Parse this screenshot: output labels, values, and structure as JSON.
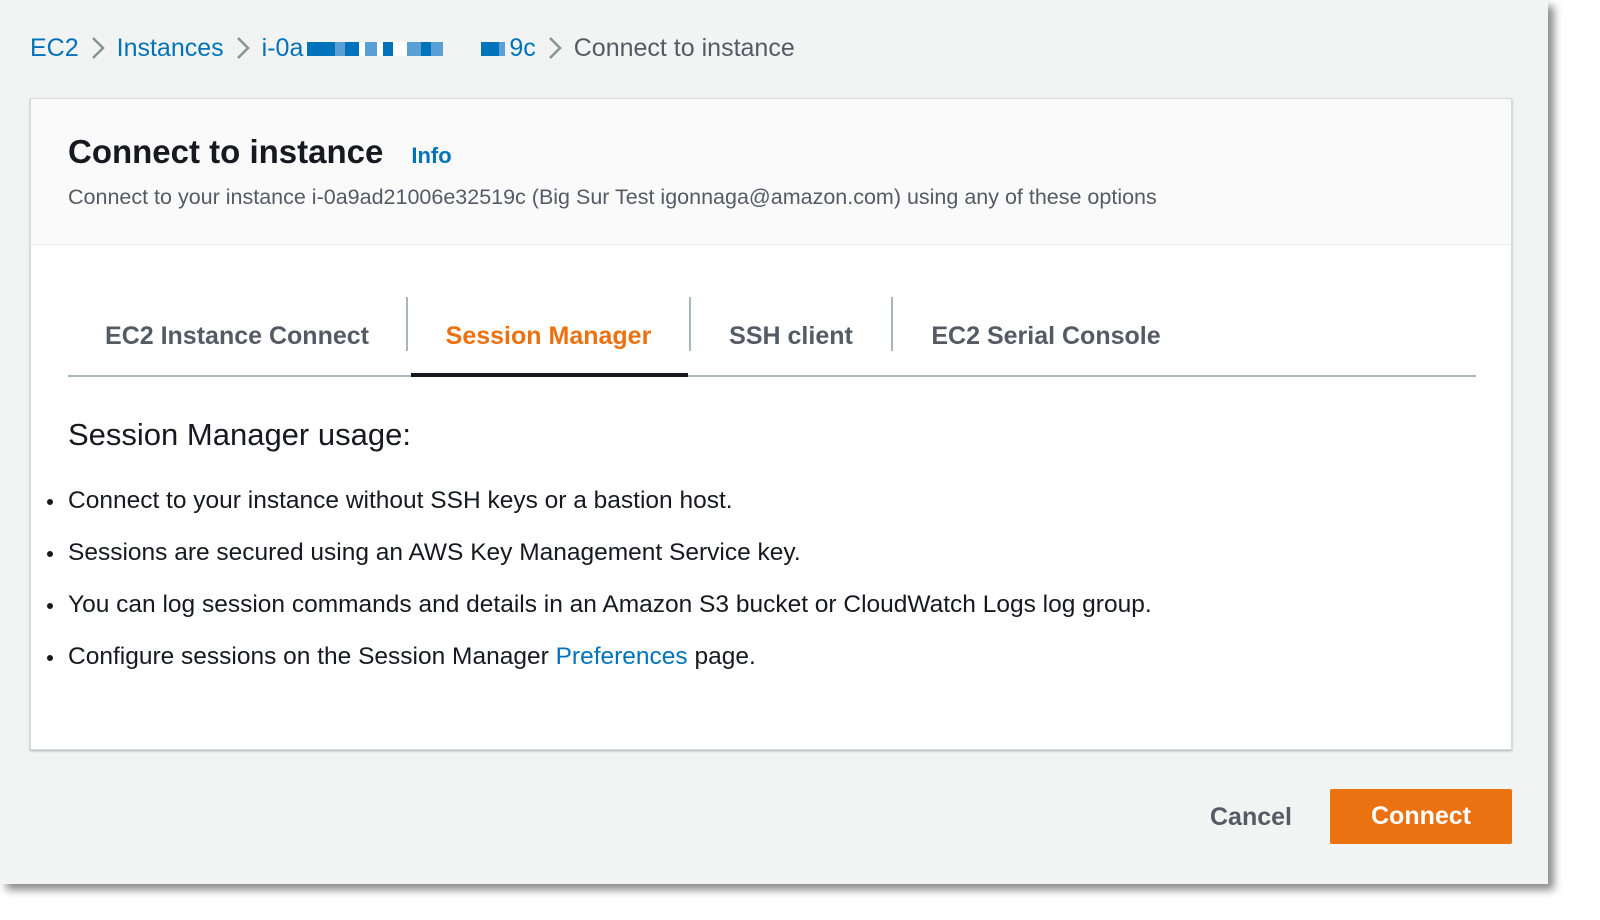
{
  "breadcrumb": {
    "items": [
      "EC2",
      "Instances",
      "i-0a",
      "9c"
    ],
    "current": "Connect to instance"
  },
  "header": {
    "title": "Connect to instance",
    "info_label": "Info",
    "description": "Connect to your instance i-0a9ad21006e32519c (Big Sur Test igonnaga@amazon.com) using any of these options"
  },
  "tabs": [
    {
      "label": "EC2 Instance Connect",
      "active": false
    },
    {
      "label": "Session Manager",
      "active": true
    },
    {
      "label": "SSH client",
      "active": false
    },
    {
      "label": "EC2 Serial Console",
      "active": false
    }
  ],
  "session_manager": {
    "usage_title": "Session Manager usage:",
    "bullets": [
      "Connect to your instance without SSH keys or a bastion host.",
      "Sessions are secured using an AWS Key Management Service key.",
      "You can log session commands and details in an Amazon S3 bucket or CloudWatch Logs log group."
    ],
    "configure": {
      "before": "Configure sessions on the Session Manager ",
      "link": "Preferences",
      "after": " page."
    }
  },
  "footer": {
    "cancel_label": "Cancel",
    "connect_label": "Connect"
  },
  "colors": {
    "link": "#0073bb",
    "accent": "#ec7211",
    "text": "#16191f",
    "muted": "#545b64",
    "background": "#f2f3f3"
  }
}
